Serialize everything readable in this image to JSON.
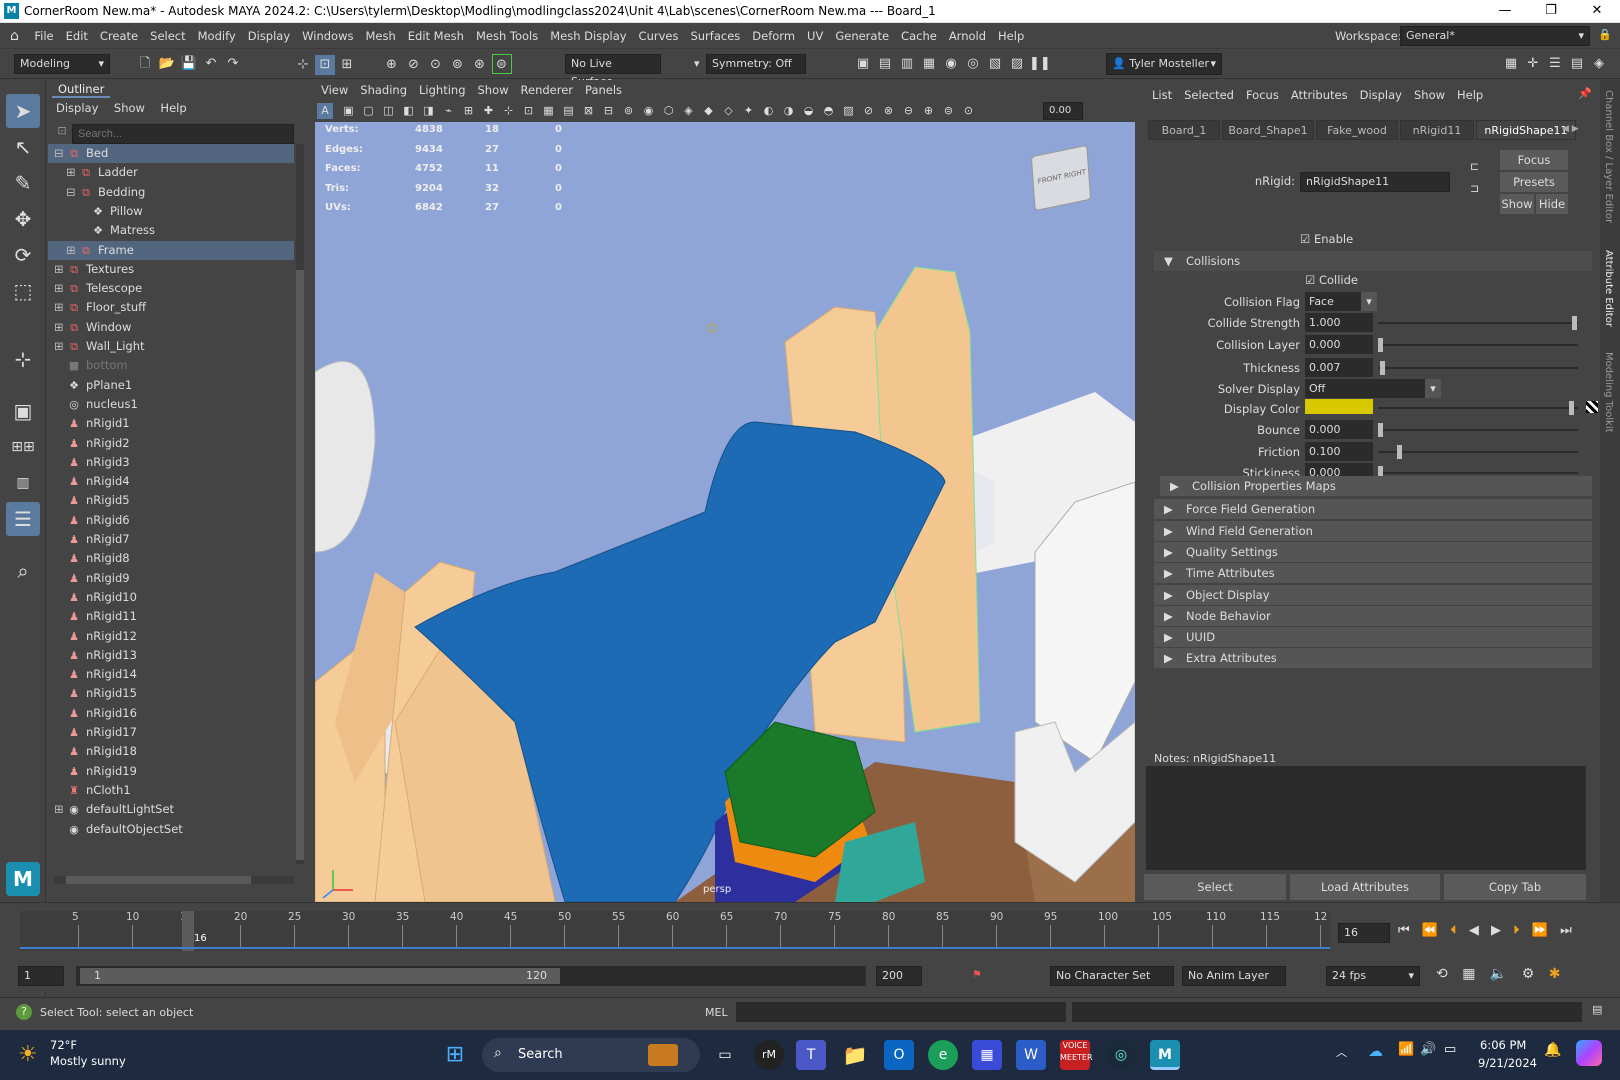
{
  "window": {
    "title": "CornerRoom New.ma* - Autodesk MAYA 2024.2: C:\\Users\\tylerm\\Desktop\\Modling\\modlingclass2024\\Unit 4\\Lab\\scenes\\CornerRoom New.ma   ---   Board_1",
    "logo": "M",
    "minimize": "—",
    "maximize": "❐",
    "close": "✕"
  },
  "menubar": {
    "items": [
      "File",
      "Edit",
      "Create",
      "Select",
      "Modify",
      "Display",
      "Windows",
      "Mesh",
      "Edit Mesh",
      "Mesh Tools",
      "Mesh Display",
      "Curves",
      "Surfaces",
      "Deform",
      "UV",
      "Generate",
      "Cache",
      "Arnold",
      "Help"
    ],
    "workspace_label": "Workspace:",
    "workspace_value": "General*"
  },
  "shelf": {
    "mode": "Modeling",
    "live_surface": "No Live Surface",
    "symmetry": "Symmetry: Off",
    "user": "Tyler Mosteller"
  },
  "outliner": {
    "title": "Outliner",
    "menus": [
      "Display",
      "Show",
      "Help"
    ],
    "search_placeholder": "Search...",
    "rows": [
      {
        "label": "Bed",
        "selected": true,
        "indent": 1,
        "expander": "⊟",
        "icon": "mesh"
      },
      {
        "label": "Ladder",
        "selected": false,
        "indent": 2,
        "expander": "⊞",
        "icon": "mesh"
      },
      {
        "label": "Bedding",
        "selected": false,
        "indent": 2,
        "expander": "⊟",
        "icon": "mesh"
      },
      {
        "label": "Pillow",
        "selected": false,
        "indent": 3,
        "expander": "",
        "icon": "poly"
      },
      {
        "label": "Matress",
        "selected": false,
        "indent": 3,
        "expander": "",
        "icon": "poly"
      },
      {
        "label": "Frame",
        "selected": true,
        "indent": 2,
        "expander": "⊞",
        "icon": "mesh"
      },
      {
        "label": "Textures",
        "selected": false,
        "indent": 1,
        "expander": "⊞",
        "icon": "mesh"
      },
      {
        "label": "Telescope",
        "selected": false,
        "indent": 1,
        "expander": "⊞",
        "icon": "mesh"
      },
      {
        "label": "Floor_stuff",
        "selected": false,
        "indent": 1,
        "expander": "⊞",
        "icon": "mesh"
      },
      {
        "label": "Window",
        "selected": false,
        "indent": 1,
        "expander": "⊞",
        "icon": "mesh"
      },
      {
        "label": "Wall_Light",
        "selected": false,
        "indent": 1,
        "expander": "⊞",
        "icon": "mesh"
      },
      {
        "label": "bottom",
        "selected": false,
        "indent": 1,
        "expander": "",
        "icon": "camera",
        "dim": true
      },
      {
        "label": "pPlane1",
        "selected": false,
        "indent": 1,
        "expander": "",
        "icon": "poly"
      },
      {
        "label": "nucleus1",
        "selected": false,
        "indent": 1,
        "expander": "",
        "icon": "nucleus"
      },
      {
        "label": "nRigid1",
        "selected": false,
        "indent": 1,
        "expander": "",
        "icon": "rigid"
      },
      {
        "label": "nRigid2",
        "selected": false,
        "indent": 1,
        "expander": "",
        "icon": "rigid"
      },
      {
        "label": "nRigid3",
        "selected": false,
        "indent": 1,
        "expander": "",
        "icon": "rigid"
      },
      {
        "label": "nRigid4",
        "selected": false,
        "indent": 1,
        "expander": "",
        "icon": "rigid"
      },
      {
        "label": "nRigid5",
        "selected": false,
        "indent": 1,
        "expander": "",
        "icon": "rigid"
      },
      {
        "label": "nRigid6",
        "selected": false,
        "indent": 1,
        "expander": "",
        "icon": "rigid"
      },
      {
        "label": "nRigid7",
        "selected": false,
        "indent": 1,
        "expander": "",
        "icon": "rigid"
      },
      {
        "label": "nRigid8",
        "selected": false,
        "indent": 1,
        "expander": "",
        "icon": "rigid"
      },
      {
        "label": "nRigid9",
        "selected": false,
        "indent": 1,
        "expander": "",
        "icon": "rigid"
      },
      {
        "label": "nRigid10",
        "selected": false,
        "indent": 1,
        "expander": "",
        "icon": "rigid"
      },
      {
        "label": "nRigid11",
        "selected": false,
        "indent": 1,
        "expander": "",
        "icon": "rigid"
      },
      {
        "label": "nRigid12",
        "selected": false,
        "indent": 1,
        "expander": "",
        "icon": "rigid"
      },
      {
        "label": "nRigid13",
        "selected": false,
        "indent": 1,
        "expander": "",
        "icon": "rigid"
      },
      {
        "label": "nRigid14",
        "selected": false,
        "indent": 1,
        "expander": "",
        "icon": "rigid"
      },
      {
        "label": "nRigid15",
        "selected": false,
        "indent": 1,
        "expander": "",
        "icon": "rigid"
      },
      {
        "label": "nRigid16",
        "selected": false,
        "indent": 1,
        "expander": "",
        "icon": "rigid"
      },
      {
        "label": "nRigid17",
        "selected": false,
        "indent": 1,
        "expander": "",
        "icon": "rigid"
      },
      {
        "label": "nRigid18",
        "selected": false,
        "indent": 1,
        "expander": "",
        "icon": "rigid"
      },
      {
        "label": "nRigid19",
        "selected": false,
        "indent": 1,
        "expander": "",
        "icon": "rigid"
      },
      {
        "label": "nCloth1",
        "selected": false,
        "indent": 1,
        "expander": "",
        "icon": "cloth"
      },
      {
        "label": "defaultLightSet",
        "selected": false,
        "indent": 1,
        "expander": "⊞",
        "icon": "set"
      },
      {
        "label": "defaultObjectSet",
        "selected": false,
        "indent": 1,
        "expander": "",
        "icon": "set"
      }
    ]
  },
  "viewport": {
    "menus": [
      "View",
      "Shading",
      "Lighting",
      "Show",
      "Renderer",
      "Panels"
    ],
    "exposure": "0.00",
    "camera": "persp",
    "stats": [
      {
        "name": "Verts:",
        "a": "4838",
        "b": "18",
        "c": "0"
      },
      {
        "name": "Edges:",
        "a": "9434",
        "b": "27",
        "c": "0"
      },
      {
        "name": "Faces:",
        "a": "4752",
        "b": "11",
        "c": "0"
      },
      {
        "name": "Tris:",
        "a": "9204",
        "b": "32",
        "c": "0"
      },
      {
        "name": "UVs:",
        "a": "6842",
        "b": "27",
        "c": "0"
      }
    ],
    "cube_front": "FRONT",
    "cube_right": "RIGHT"
  },
  "attribute_editor": {
    "menus": [
      "List",
      "Selected",
      "Focus",
      "Attributes",
      "Display",
      "Show",
      "Help"
    ],
    "tabs": [
      "Board_1",
      "Board_Shape1",
      "Fake_wood",
      "nRigid11",
      "nRigidShape11"
    ],
    "node_label": "nRigid:",
    "node_value": "nRigidShape11",
    "focus_btn": "Focus",
    "presets_btn": "Presets",
    "show_btn": "Show",
    "hide_btn": "Hide",
    "enable_label": "Enable",
    "collisions_title": "Collisions",
    "collide_label": "Collide",
    "fields": [
      {
        "label": "Collision Flag",
        "value": "Face",
        "type": "dropdown"
      },
      {
        "label": "Collide Strength",
        "value": "1.000",
        "type": "slider",
        "level": 1.0
      },
      {
        "label": "Collision Layer",
        "value": "0.000",
        "type": "slider",
        "level": 0.0
      },
      {
        "label": "Thickness",
        "value": "0.007",
        "type": "slider",
        "level": 0.01
      },
      {
        "label": "Solver Display",
        "value": "Off",
        "type": "dropdown"
      },
      {
        "label": "Display Color",
        "value": "",
        "type": "color",
        "level": 0.97
      },
      {
        "label": "Bounce",
        "value": "0.000",
        "type": "slider",
        "level": 0.0
      },
      {
        "label": "Friction",
        "value": "0.100",
        "type": "slider",
        "level": 0.1
      },
      {
        "label": "Stickiness",
        "value": "0.000",
        "type": "slider",
        "level": 0.0
      }
    ],
    "display_color": "#d8c800",
    "sections": [
      "Collision Properties Maps",
      "Force Field Generation",
      "Wind Field Generation",
      "Quality Settings",
      "Time Attributes",
      "Object Display",
      "Node Behavior",
      "UUID",
      "Extra Attributes"
    ],
    "notes_label": "Notes:  nRigidShape11",
    "select_btn": "Select",
    "load_btn": "Load Attributes",
    "copy_btn": "Copy Tab",
    "side_tabs": [
      "Channel Box / Layer Editor",
      "Attribute Editor",
      "Modeling Toolkit"
    ]
  },
  "timeline": {
    "ticks": [
      "5",
      "10",
      "15",
      "20",
      "25",
      "30",
      "35",
      "40",
      "45",
      "50",
      "55",
      "60",
      "65",
      "70",
      "75",
      "80",
      "85",
      "90",
      "95",
      "100",
      "105",
      "110",
      "115",
      "12"
    ],
    "current_frame": "16",
    "frame_field": "16"
  },
  "range": {
    "start": "1",
    "inner_start": "1",
    "inner_end": "120",
    "end": "200",
    "character_set": "No Character Set",
    "anim_layer": "No Anim Layer",
    "fps": "24 fps"
  },
  "command": {
    "help": "Select Tool: select an object",
    "lang": "MEL"
  },
  "taskbar": {
    "weather_temp": "72°F",
    "weather_desc": "Mostly sunny",
    "search": "Search",
    "time": "6:06 PM",
    "date": "9/21/2024"
  }
}
